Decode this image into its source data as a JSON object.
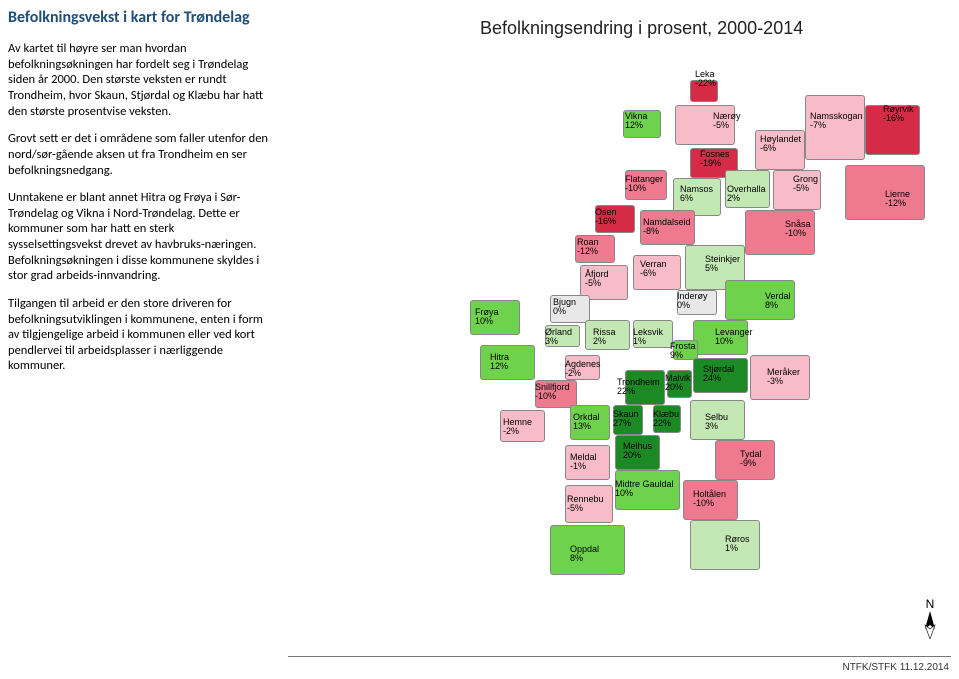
{
  "title": "Befolkningsvekst i kart for Trøndelag",
  "chart_title": "Befolkningsendring i prosent, 2000-2014",
  "para1": "Av kartet til høyre ser man hvordan befolkningsøkningen har fordelt seg i Trøndelag siden år 2000. Den største veksten er rundt Trondheim, hvor Skaun, Stjørdal og Klæbu har hatt den største prosentvise veksten.",
  "para2": "Grovt sett er det i områdene som faller utenfor den nord/sør-gående aksen ut fra Trondheim en ser befolkningsnedgang.",
  "para3": "Unntakene er blant annet Hitra og Frøya i Sør-Trøndelag og Vikna i Nord-Trøndelag. Dette er kommuner som har hatt en sterk sysselsettingsvekst drevet av havbruks-næringen. Befolkningsøkningen i disse kommunene skyldes i stor grad arbeids-innvandring.",
  "para4": "Tilgangen til arbeid er den store driveren for befolkningsutviklingen i kommunene, enten i form av tilgjengelige arbeid i kommunen eller ved kort pendlervei til arbeidsplasser i nærliggende kommuner.",
  "compass_label": "N",
  "footer": "NTFK/STFK 11.12.2014",
  "chart_data": {
    "type": "map",
    "title": "Befolkningsendring i prosent, 2000-2014",
    "unit": "percent",
    "region": "Trøndelag",
    "municipalities": [
      {
        "name": "Leka",
        "value": -22
      },
      {
        "name": "Vikna",
        "value": 12
      },
      {
        "name": "Nærøy",
        "value": -5
      },
      {
        "name": "Namsskogan",
        "value": -7
      },
      {
        "name": "Røyrvik",
        "value": -16
      },
      {
        "name": "Høylandet",
        "value": -6
      },
      {
        "name": "Fosnes",
        "value": -19
      },
      {
        "name": "Flatanger",
        "value": -10
      },
      {
        "name": "Namsos",
        "value": 6
      },
      {
        "name": "Overhalla",
        "value": 2
      },
      {
        "name": "Grong",
        "value": -5
      },
      {
        "name": "Lierne",
        "value": -12
      },
      {
        "name": "Osen",
        "value": -16
      },
      {
        "name": "Namdalseid",
        "value": -8
      },
      {
        "name": "Snåsa",
        "value": -10
      },
      {
        "name": "Roan",
        "value": -12
      },
      {
        "name": "Steinkjer",
        "value": 5
      },
      {
        "name": "Åfjord",
        "value": -5
      },
      {
        "name": "Verran",
        "value": -6
      },
      {
        "name": "Inderøy",
        "value": 0
      },
      {
        "name": "Verdal",
        "value": 8
      },
      {
        "name": "Bjugn",
        "value": 0
      },
      {
        "name": "Frøya",
        "value": 10
      },
      {
        "name": "Ørland",
        "value": 3
      },
      {
        "name": "Rissa",
        "value": 2
      },
      {
        "name": "Leksvik",
        "value": 1
      },
      {
        "name": "Levanger",
        "value": 10
      },
      {
        "name": "Frosta",
        "value": 9
      },
      {
        "name": "Hitra",
        "value": 12
      },
      {
        "name": "Agdenes",
        "value": -2
      },
      {
        "name": "Stjørdal",
        "value": 24
      },
      {
        "name": "Meråker",
        "value": -3
      },
      {
        "name": "Snillfjord",
        "value": -10
      },
      {
        "name": "Trondheim",
        "value": 22
      },
      {
        "name": "Malvik",
        "value": 20
      },
      {
        "name": "Hemne",
        "value": -2
      },
      {
        "name": "Orkdal",
        "value": 13
      },
      {
        "name": "Skaun",
        "value": 27
      },
      {
        "name": "Klæbu",
        "value": 22
      },
      {
        "name": "Selbu",
        "value": 3
      },
      {
        "name": "Melhus",
        "value": 20
      },
      {
        "name": "Meldal",
        "value": -1
      },
      {
        "name": "Tydal",
        "value": -9
      },
      {
        "name": "Midtre Gauldal",
        "value": 10
      },
      {
        "name": "Holtålen",
        "value": -10
      },
      {
        "name": "Rennebu",
        "value": -5
      },
      {
        "name": "Oppdal",
        "value": 8
      },
      {
        "name": "Røros",
        "value": 1
      }
    ]
  },
  "labels": {
    "Leka": "Leka",
    "Vikna": "Vikna",
    "Naeroy": "Nærøy",
    "Namsskogan": "Namsskogan",
    "Royrvik": "Røyrvik",
    "Hoylandet": "Høylandet",
    "Fosnes": "Fosnes",
    "Flatanger": "Flatanger",
    "Namsos": "Namsos",
    "Overhalla": "Overhalla",
    "Grong": "Grong",
    "Lierne": "Lierne",
    "Osen": "Osen",
    "Namdalseid": "Namdalseid",
    "Snasa": "Snåsa",
    "Roan": "Roan",
    "Steinkjer": "Steinkjer",
    "Afjord": "Åfjord",
    "Verran": "Verran",
    "Inderoy": "Inderøy",
    "Verdal": "Verdal",
    "Bjugn": "Bjugn",
    "Froya": "Frøya",
    "Orland": "Ørland",
    "Rissa": "Rissa",
    "Leksvik": "Leksvik",
    "Levanger": "Levanger",
    "Frosta": "Frosta",
    "Hitra": "Hitra",
    "Agdenes": "Agdenes",
    "Stjordal": "Stjørdal",
    "Meraker": "Meråker",
    "Snillfjord": "Snillfjord",
    "Trondheim": "Trondheim",
    "Malvik": "Malvik",
    "Hemne": "Hemne",
    "Orkdal": "Orkdal",
    "Skaun": "Skaun",
    "Klaebu": "Klæbu",
    "Selbu": "Selbu",
    "Melhus": "Melhus",
    "Meldal": "Meldal",
    "Tydal": "Tydal",
    "MidtreGauldal": "Midtre Gauldal",
    "Holtalen": "Holtålen",
    "Rennebu": "Rennebu",
    "Oppdal": "Oppdal",
    "Roros": "Røros"
  },
  "values": {
    "Leka": "-22%",
    "Vikna": "12%",
    "Naeroy": "-5%",
    "Namsskogan": "-7%",
    "Royrvik": "-16%",
    "Hoylandet": "-6%",
    "Fosnes": "-19%",
    "Flatanger": "-10%",
    "Namsos": "6%",
    "Overhalla": "2%",
    "Grong": "-5%",
    "Lierne": "-12%",
    "Osen": "-16%",
    "Namdalseid": "-8%",
    "Snasa": "-10%",
    "Roan": "-12%",
    "Steinkjer": "5%",
    "Afjord": "-5%",
    "Verran": "-6%",
    "Inderoy": "0%",
    "Verdal": "8%",
    "Bjugn": "0%",
    "Froya": "10%",
    "Orland": "3%",
    "Rissa": "2%",
    "Leksvik": "1%",
    "Levanger": "10%",
    "Frosta": "9%",
    "Hitra": "12%",
    "Agdenes": "-2%",
    "Stjordal": "24%",
    "Meraker": "-3%",
    "Snillfjord": "-10%",
    "Trondheim": "22%",
    "Malvik": "20%",
    "Hemne": "-2%",
    "Orkdal": "13%",
    "Skaun": "27%",
    "Klaebu": "22%",
    "Selbu": "3%",
    "Melhus": "20%",
    "Meldal": "-1%",
    "Tydal": "-9%",
    "MidtreGauldal": "10%",
    "Holtalen": "-10%",
    "Rennebu": "-5%",
    "Oppdal": "8%",
    "Roros": "1%"
  }
}
